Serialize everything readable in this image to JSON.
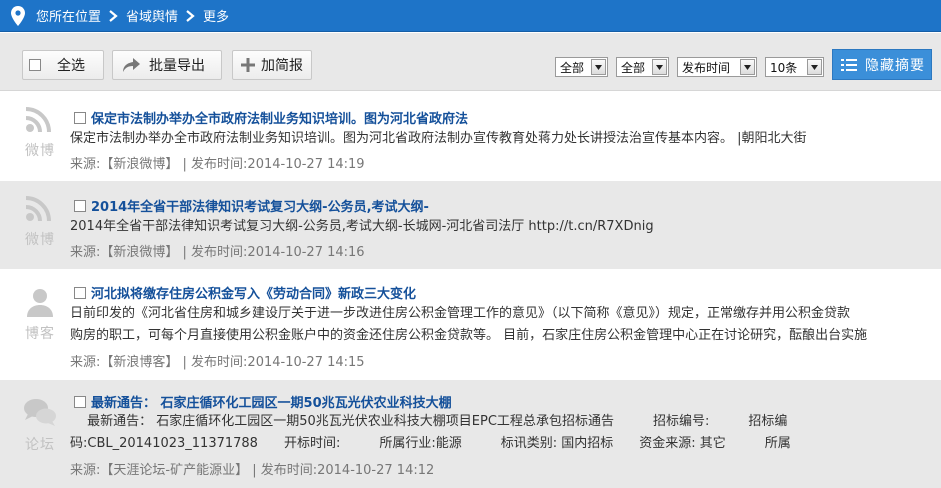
{
  "breadcrumb": {
    "prefix": "您所在位置",
    "level1": "省域舆情",
    "level2": "更多"
  },
  "toolbar": {
    "select_all": "全选",
    "export": "批量导出",
    "add_brief": "加简报",
    "filter1": "全部",
    "filter2": "全部",
    "sort": "发布时间",
    "page_size": "10条",
    "hide_summary": "隐藏摘要"
  },
  "items": [
    {
      "source_label": "微博",
      "icon": "wifi-icon",
      "title": "保定市法制办举办全市政府法制业务知识培训。图为河北省政府法",
      "summary_1": "保定市法制办举办全市政府法制业务知识培训。图为河北省政府法制办宣传教育处蒋力处长讲授法治宣传基本内容。 |朝阳北大街",
      "source": "来源:【新浪微博】",
      "time": "| 发布时间:2014-10-27 14:19"
    },
    {
      "source_label": "微博",
      "icon": "wifi-icon",
      "title": "2014年全省干部法律知识考试复习大纲-公务员,考试大纲-",
      "summary_1": "2014年全省干部法律知识考试复习大纲-公务员,考试大纲-长城网-河北省司法厅 http://t.cn/R7XDnig",
      "source": "来源:【新浪微博】",
      "time": "| 发布时间:2014-10-27 14:16"
    },
    {
      "source_label": "博客",
      "icon": "user-icon",
      "title": "河北拟将缴存住房公积金写入《劳动合同》新政三大变化",
      "summary_1": "日前印发的《河北省住房和城乡建设厅关于进一步改进住房公积金管理工作的意见》（以下简称《意见》）规定，正常缴存并用公积金贷款",
      "summary_2": "购房的职工，可每个月直接使用公积金账户中的资金还住房公积金贷款等。 目前，石家庄住房公积金管理中心正在讨论研究，酝酿出台实施",
      "source": "来源:【新浪博客】",
      "time": "| 发布时间:2014-10-27 14:15"
    },
    {
      "source_label": "论坛",
      "icon": "chat-bubbles-icon",
      "title": "最新通告： 石家庄循环化工园区一期50兆瓦光伏农业科技大棚",
      "summary_1": "　 最新通告： 石家庄循环化工园区一期50兆瓦光伏农业科技大棚项目EPC工程总承包招标通告　　　招标编号:　　　招标编",
      "summary_2": "码:CBL_20141023_11371788　　开标时间:　　　所属行业:能源　　　标讯类别: 国内招标　　资金来源: 其它　　　所属",
      "source": "来源:【天涯论坛-矿产能源业】",
      "time": "| 发布时间:2014-10-27 14:12"
    }
  ],
  "colors": {
    "topbar": "#1e74c8",
    "title_link": "#14509a",
    "accent_button": "#3b8fd9"
  }
}
